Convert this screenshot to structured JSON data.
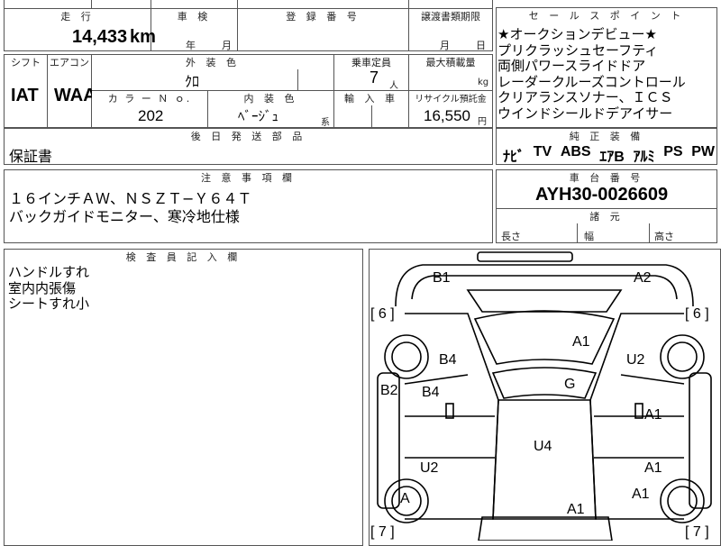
{
  "top": {
    "mileage_label": "走 行",
    "inspection_label": "車 検",
    "registration_label": "登 録 番 号",
    "transfer_label": "譲渡書類期限",
    "mileage_value": "14,433",
    "mileage_unit": "km",
    "inspection_year": "年",
    "inspection_month": "月",
    "transfer_month": "月",
    "transfer_day": "日"
  },
  "specs": {
    "shift_label": "シフト",
    "aircon_label": "エアコン",
    "exterior_label": "外 装 色",
    "seats_label": "乗車定員",
    "maxload_label": "最大積載量",
    "shift_value": "IAT",
    "aircon_value": "WAA",
    "exterior_value": "ｸﾛ",
    "seats_value": "7",
    "seats_unit": "人",
    "maxload_unit": "kg",
    "color_no_label": "カ ラ ー Ｎ ｏ.",
    "interior_label": "内 装 色",
    "import_label": "輸 入 車",
    "recycle_label": "リサイクル預託金",
    "color_no_value": "202",
    "interior_value": "ﾍﾞｰｼﾞｭ",
    "interior_suffix": "系",
    "recycle_value": "16,550",
    "recycle_unit": "円"
  },
  "later_parts": {
    "label": "後 日 発 送 部 品",
    "value": "保証書"
  },
  "notes": {
    "label": "注 意 事 項 欄",
    "line1": "１６インチＡＷ、ＮＳＺＴ−Ｙ６４Ｔ",
    "line2": "バックガイドモニター、寒冷地仕様"
  },
  "sales_points": {
    "label": "セ ー ル ス ポ イ ン ト",
    "items": [
      "★オークションデビュー★",
      "プリクラッシュセーフティ",
      "両側パワースライドドア",
      "レーダークルーズコントロール",
      "クリアランスソナー、ＩＣＳ",
      "ウインドシールドデアイサー"
    ]
  },
  "equipment": {
    "label": "純 正 装 備",
    "items": [
      "ﾅﾋﾞ",
      "TV",
      "ABS",
      "ｴｱB",
      "ｱﾙﾐ",
      "PS",
      "PW"
    ]
  },
  "chassis": {
    "label": "車 台 番 号",
    "value": "AYH30-0026609"
  },
  "dimensions": {
    "label": "諸 元",
    "length": "長さ",
    "width": "幅",
    "height": "高さ"
  },
  "inspector": {
    "label": "検 査 員 記 入 欄",
    "lines": [
      "ハンドルすれ",
      "室内内張傷",
      "シートすれ小"
    ]
  },
  "car_map": {
    "tire_fl": "[ 6 ]",
    "tire_fr": "[ 6 ]",
    "tire_rl": "[ 7 ]",
    "tire_rr": "[ 7 ]",
    "marks": {
      "b1": "B1",
      "a2": "A2",
      "a1_hood": "A1",
      "b4_front": "B4",
      "u2_right": "U2",
      "b2": "B2",
      "b4_door": "B4",
      "g": "G",
      "a1_rdoor": "A1",
      "u4": "U4",
      "u2_rear": "U2",
      "a1_rdoor2": "A1",
      "a_left": "A",
      "a1_rfender": "A1",
      "a1_rear": "A1"
    }
  }
}
